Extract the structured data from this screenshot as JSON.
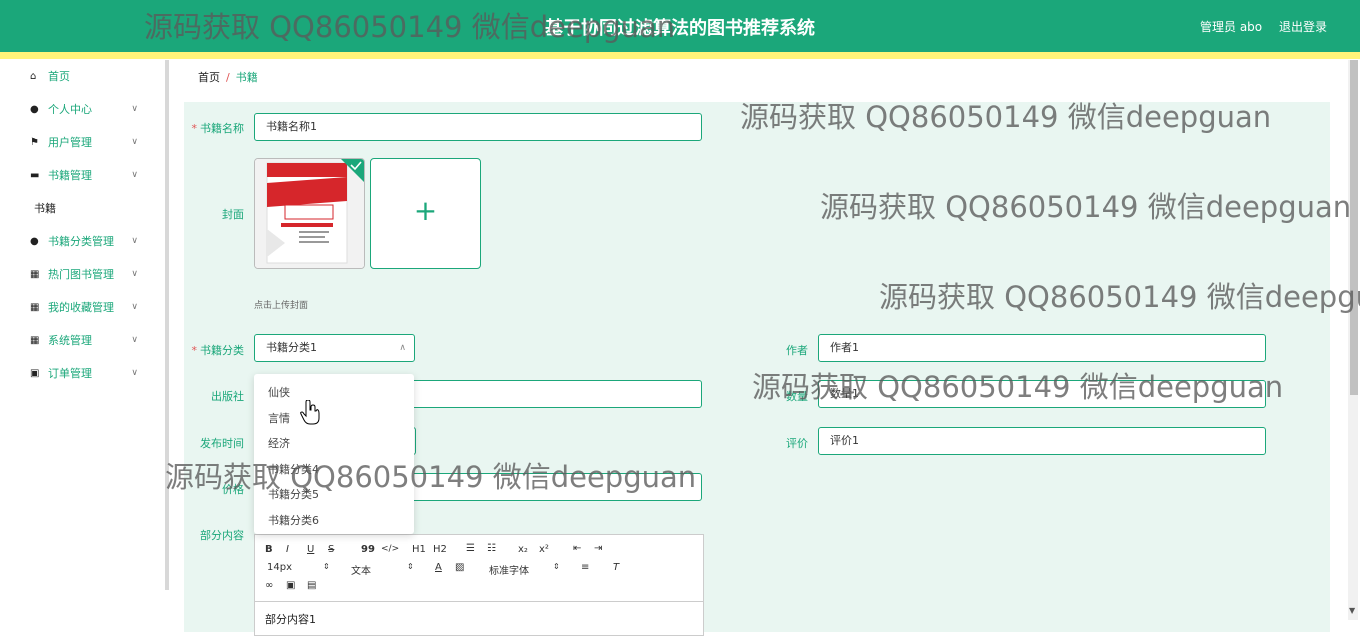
{
  "header": {
    "title": "基于协同过滤算法的图书推荐系统",
    "admin_label": "管理员 abo",
    "logout_label": "退出登录"
  },
  "sidebar": {
    "items": [
      {
        "label": "首页",
        "icon": "home-icon"
      },
      {
        "label": "个人中心",
        "icon": "user-icon"
      },
      {
        "label": "用户管理",
        "icon": "flag-icon"
      },
      {
        "label": "书籍管理",
        "icon": "briefcase-icon"
      },
      {
        "label": "书籍分类管理",
        "icon": "user-icon"
      },
      {
        "label": "热门图书管理",
        "icon": "grid-icon"
      },
      {
        "label": "我的收藏管理",
        "icon": "grid-icon"
      },
      {
        "label": "系统管理",
        "icon": "grid-icon"
      },
      {
        "label": "订单管理",
        "icon": "cart-icon"
      }
    ],
    "sub_item": "书籍"
  },
  "breadcrumb": {
    "home": "首页",
    "separator": "/",
    "current": "书籍"
  },
  "form": {
    "book_name_label": "书籍名称",
    "book_name_value": "书籍名称1",
    "cover_label": "封面",
    "upload_plus": "+",
    "upload_tip": "点击上传封面",
    "category_label": "书籍分类",
    "category_value": "书籍分类1",
    "author_label": "作者",
    "author_value": "作者1",
    "publisher_label": "出版社",
    "quantity_label": "数量",
    "quantity_value": "数量1",
    "publish_time_label": "发布时间",
    "rating_label": "评价",
    "rating_value": "评价1",
    "price_label": "价格",
    "content_label": "部分内容",
    "content_value": "部分内容1"
  },
  "category_options": [
    "仙侠",
    "言情",
    "经济",
    "书籍分类4",
    "书籍分类5",
    "书籍分类6"
  ],
  "editor_toolbar": {
    "bold": "B",
    "italic": "I",
    "underline": "U",
    "strike": "S",
    "quote": "99",
    "code": "</>",
    "h1": "H1",
    "h2": "H2",
    "subscript": "x₂",
    "superscript": "x²",
    "font_size": "14px",
    "text_style": "文本",
    "font_family": "标准字体"
  },
  "watermark": "源码获取 QQ86050149 微信deepguan",
  "colors": {
    "primary": "#1ba77a",
    "header_stripe": "#fff47a",
    "form_bg": "#e9f6f1",
    "required": "#e05555"
  }
}
